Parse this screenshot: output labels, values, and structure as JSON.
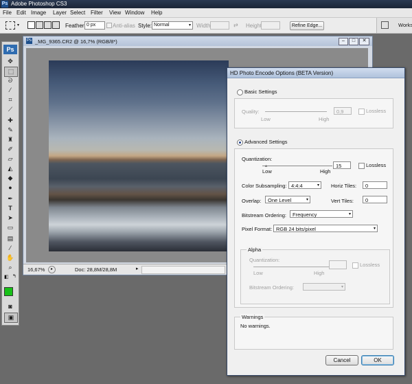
{
  "app": {
    "title": "Adobe Photoshop CS3",
    "logo": "Ps"
  },
  "menu": [
    "File",
    "Edit",
    "Image",
    "Layer",
    "Select",
    "Filter",
    "View",
    "Window",
    "Help"
  ],
  "options": {
    "feather_label": "Feather:",
    "feather_value": "0 px",
    "antialias_label": "Anti-alias",
    "style_label": "Style:",
    "style_value": "Normal",
    "width_label": "Width:",
    "height_label": "Height:",
    "refine_label": "Refine Edge...",
    "workspace_label": "Workspace"
  },
  "toolbox": {
    "logo": "Ps",
    "foreground_color": "#18c018",
    "background_color": "#ffffff"
  },
  "document": {
    "title": "_MG_9365.CR2 @ 16,7% (RGB/8*)",
    "zoom": "16,67%",
    "doc_info": "Doc: 28,8M/28,8M"
  },
  "dialog": {
    "title": "HD Photo Encode Options (BETA Version)",
    "basic": {
      "label": "Basic Settings",
      "selected": false,
      "quality_label": "Quality:",
      "quality_value": "0,9",
      "low": "Low",
      "high": "High",
      "lossless": "Lossless"
    },
    "advanced": {
      "label": "Advanced Settings",
      "selected": true,
      "quantization_label": "Quantization:",
      "quantization_value": "15",
      "low": "Low",
      "high": "High",
      "lossless": "Lossless",
      "color_subsampling_label": "Color Subsampling:",
      "color_subsampling_value": "4:4:4",
      "horiz_tiles_label": "Horiz Tiles:",
      "horiz_tiles_value": "0",
      "overlap_label": "Overlap:",
      "overlap_value": "One Level",
      "vert_tiles_label": "Vert Tiles:",
      "vert_tiles_value": "0",
      "bitstream_label": "Bitstream Ordering:",
      "bitstream_value": "Frequency",
      "pixel_format_label": "Pixel Format:",
      "pixel_format_value": "RGB 24 bits/pixel"
    },
    "alpha": {
      "label": "Alpha",
      "quantization_label": "Quantization:",
      "low": "Low",
      "high": "High",
      "lossless": "Lossless",
      "bitstream_label": "Bitstream Ordering:"
    },
    "warnings": {
      "label": "Warnings",
      "text": "No warnings."
    },
    "cancel_label": "Cancel",
    "ok_label": "OK"
  }
}
